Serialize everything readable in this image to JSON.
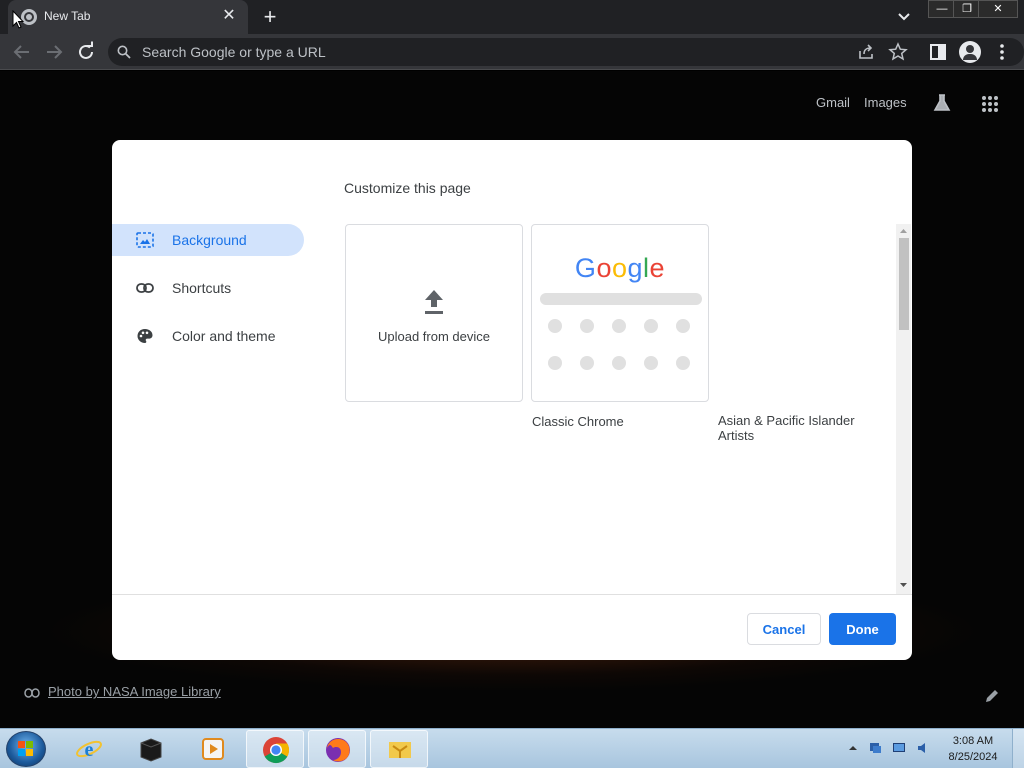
{
  "browser": {
    "tab": {
      "title": "New Tab",
      "close": "✕"
    },
    "new_tab": "+",
    "window_controls": {
      "minimize": "—",
      "maximize": "❐",
      "close": "✕"
    },
    "omnibox": {
      "placeholder": "Search Google or type a URL",
      "value": ""
    }
  },
  "ntp": {
    "links": {
      "gmail": "Gmail",
      "images": "Images"
    },
    "photo_credit": "Photo by NASA Image Library"
  },
  "dialog": {
    "title": "Customize this page",
    "menu": [
      {
        "label": "Background",
        "icon": "image-icon",
        "active": true
      },
      {
        "label": "Shortcuts",
        "icon": "link-icon",
        "active": false
      },
      {
        "label": "Color and theme",
        "icon": "palette-icon",
        "active": false
      }
    ],
    "tiles": {
      "upload": "Upload from device",
      "classic_chrome": "Classic Chrome",
      "collection_1": "Asian & Pacific Islander Artists"
    },
    "buttons": {
      "cancel": "Cancel",
      "done": "Done"
    }
  },
  "taskbar": {
    "apps": [
      "internet-explorer",
      "terminal",
      "media-player",
      "chrome",
      "firefox",
      "file-manager"
    ],
    "clock": {
      "time": "3:08 AM",
      "date": "8/25/2024"
    }
  },
  "colors": {
    "accent": "#1a73e8",
    "selected_bg": "#d2e3fc",
    "toolbar": "#35363a",
    "titlebar": "#202124"
  }
}
